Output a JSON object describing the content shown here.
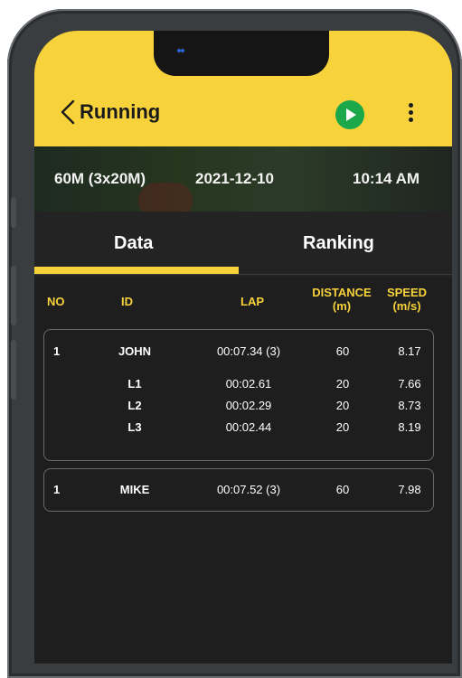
{
  "header": {
    "title": "Running",
    "back_icon": "chevron-left-icon",
    "play_icon": "play-icon",
    "more_icon": "more-vertical-icon",
    "accent_color": "#f7d23b",
    "play_color": "#1aa84b"
  },
  "info": {
    "event": "60M (3x20M)",
    "date": "2021-12-10",
    "time": "10:14 AM"
  },
  "tabs": [
    {
      "label": "Data",
      "selected": true
    },
    {
      "label": "Ranking",
      "selected": false
    }
  ],
  "table": {
    "headers": {
      "no": "NO",
      "id": "ID",
      "lap": "LAP",
      "distance": "DISTANCE",
      "distance_unit": "(m)",
      "speed": "SPEED",
      "speed_unit": "(m/s)"
    },
    "entries": [
      {
        "no": "1",
        "id": "JOHN",
        "lap": "00:07.34 (3)",
        "distance": "60",
        "speed": "8.17",
        "laps": [
          {
            "id": "L1",
            "lap": "00:02.61",
            "distance": "20",
            "speed": "7.66"
          },
          {
            "id": "L2",
            "lap": "00:02.29",
            "distance": "20",
            "speed": "8.73"
          },
          {
            "id": "L3",
            "lap": "00:02.44",
            "distance": "20",
            "speed": "8.19"
          }
        ]
      },
      {
        "no": "1",
        "id": "MIKE",
        "lap": "00:07.52 (3)",
        "distance": "60",
        "speed": "7.98",
        "laps": []
      }
    ]
  }
}
